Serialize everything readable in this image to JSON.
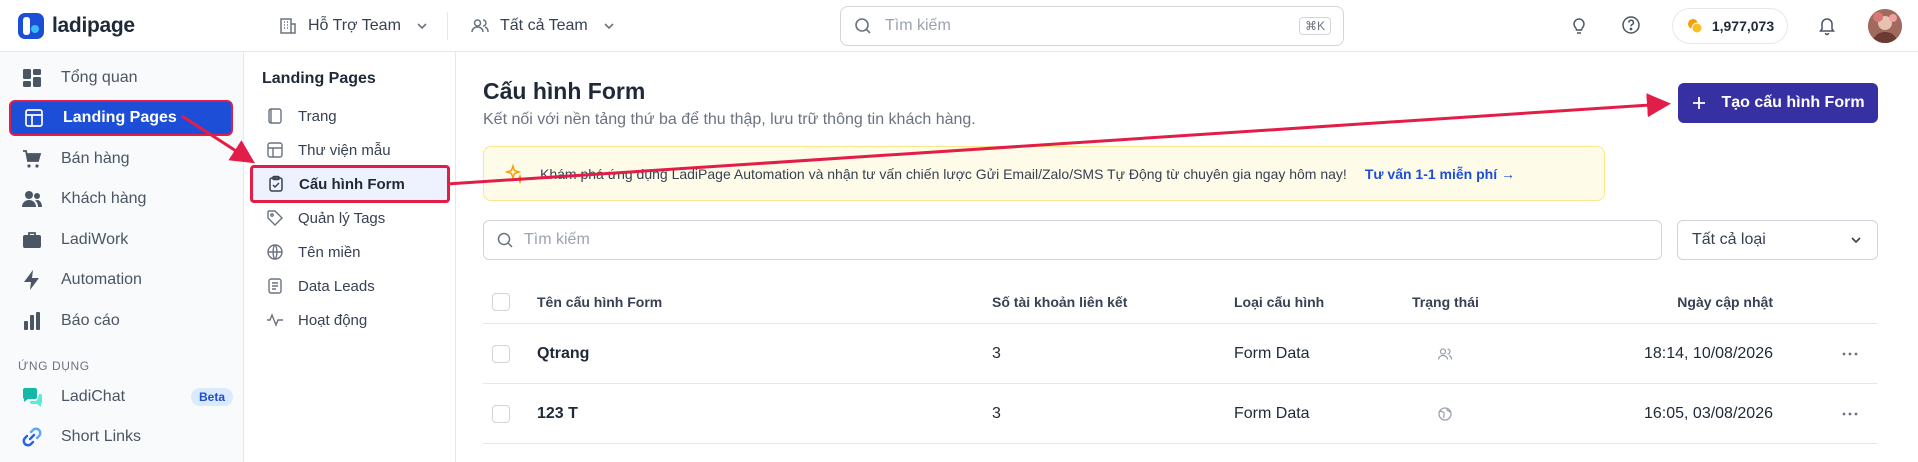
{
  "app": {
    "brand": "ladipage"
  },
  "topbar": {
    "team": "Hỗ Trợ Team",
    "team_filter": "Tất cả Team",
    "search_placeholder": "Tìm kiếm",
    "search_shortcut": "⌘K",
    "credits": "1,977,073"
  },
  "sidebar": {
    "items": [
      {
        "label": "Tổng quan",
        "icon": "grid-icon"
      },
      {
        "label": "Landing Pages",
        "icon": "layout-icon"
      },
      {
        "label": "Bán hàng",
        "icon": "cart-icon"
      },
      {
        "label": "Khách hàng",
        "icon": "users-icon"
      },
      {
        "label": "LadiWork",
        "icon": "briefcase-icon"
      },
      {
        "label": "Automation",
        "icon": "bolt-icon"
      },
      {
        "label": "Báo cáo",
        "icon": "bar-chart-icon"
      }
    ],
    "section_label": "ỨNG DỤNG",
    "apps": [
      {
        "label": "LadiChat",
        "badge": "Beta",
        "icon": "chat-icon"
      },
      {
        "label": "Short Links",
        "icon": "link-icon"
      }
    ]
  },
  "subnav": {
    "title": "Landing Pages",
    "items": [
      {
        "label": "Trang",
        "icon": "page-icon"
      },
      {
        "label": "Thư viện mẫu",
        "icon": "template-icon"
      },
      {
        "label": "Cấu hình Form",
        "icon": "clipboard-icon"
      },
      {
        "label": "Quản lý Tags",
        "icon": "tag-icon"
      },
      {
        "label": "Tên miền",
        "icon": "globe-icon"
      },
      {
        "label": "Data Leads",
        "icon": "document-icon"
      },
      {
        "label": "Hoạt động",
        "icon": "activity-icon"
      }
    ]
  },
  "main": {
    "title": "Cấu hình Form",
    "subtitle": "Kết nối với nền tảng thứ ba để thu thập, lưu trữ thông tin khách hàng.",
    "create_button": "Tạo cấu hình Form",
    "promo_text": "Khám phá ứng dụng LadiPage Automation và nhận tư vấn chiến lược Gửi Email/Zalo/SMS Tự Động từ chuyên gia ngay hôm nay!",
    "promo_link": "Tư vấn 1-1 miễn phí",
    "search_placeholder": "Tìm kiếm",
    "type_filter": "Tất cả loại"
  },
  "table": {
    "headers": [
      "Tên cấu hình Form",
      "Số tài khoản liên kết",
      "Loại cấu hình",
      "Trạng thái",
      "Ngày cập nhật"
    ],
    "rows": [
      {
        "name": "Qtrang",
        "accounts": "3",
        "type": "Form Data",
        "status_icon": "users-icon",
        "updated": "18:14, 10/08/2026"
      },
      {
        "name": "123 T",
        "accounts": "3",
        "type": "Form Data",
        "status_icon": "globe-icon",
        "updated": "16:05, 03/08/2026"
      }
    ]
  },
  "colors": {
    "primary": "#1d4ed8",
    "button": "#3730a3",
    "annotation": "#e11d48",
    "promo_bg": "#fefce8"
  }
}
